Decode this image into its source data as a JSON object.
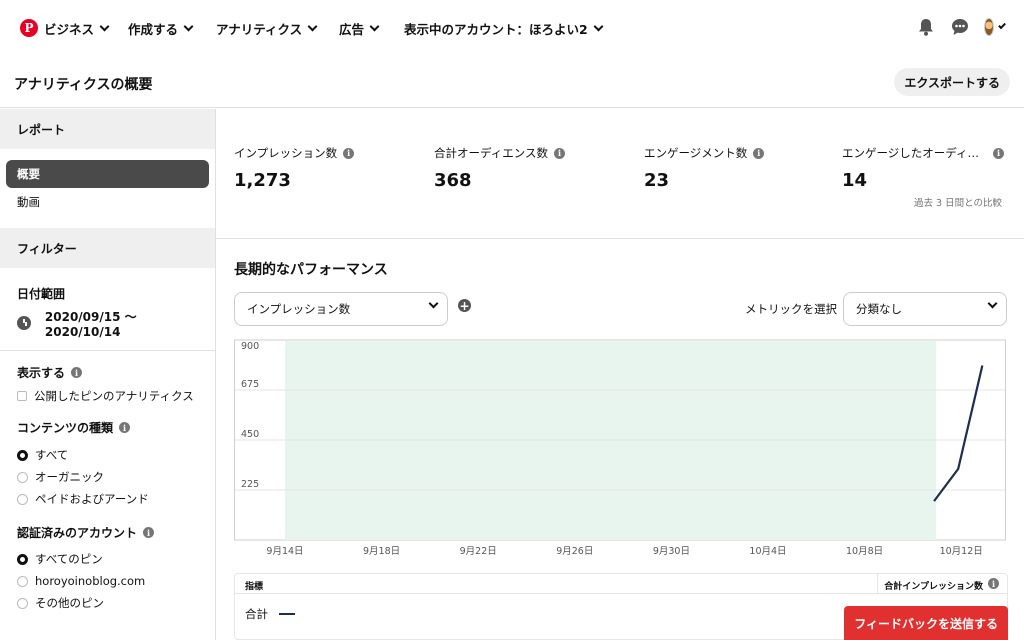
{
  "topnav": {
    "brand": "ビジネス",
    "logo_letter": "P",
    "items": [
      "作成する",
      "アナリティクス",
      "広告",
      "表示中のアカウント：ほろよい2"
    ],
    "icons": [
      "bell-icon",
      "chat-bubble-icon",
      "avatar"
    ]
  },
  "header": {
    "title": "アナリティクスの概要",
    "export_label": "エクスポートする"
  },
  "sidebar": {
    "report_head": "レポート",
    "report_items": [
      "概要",
      "動画"
    ],
    "filter_head": "フィルター",
    "date_label": "日付範囲",
    "date_value": "2020/09/15 〜 2020/10/14",
    "show_label": "表示する",
    "show_option": "公開したピンのアナリティクス",
    "content_label": "コンテンツの種類",
    "content_options": [
      "すべて",
      "オーガニック",
      "ペイドおよびアーンド"
    ],
    "account_label": "認証済みのアカウント",
    "account_options": [
      "すべてのピン",
      "horoyoinoblog.com",
      "その他のピン"
    ]
  },
  "metrics": [
    {
      "label": "インプレッション数",
      "value": "1,273"
    },
    {
      "label": "合計オーディエンス数",
      "value": "368"
    },
    {
      "label": "エンゲージメント数",
      "value": "23"
    },
    {
      "label": "エンゲージしたオーディ…",
      "value": "14"
    }
  ],
  "metrics_note": "過去 3 日間との比較",
  "performance": {
    "title": "長期的なパフォーマンス",
    "metric_select": "インプレッション数",
    "metric_pick_label": "メトリックを選択",
    "split_select": "分類なし"
  },
  "chart_data": {
    "type": "line",
    "x": [
      "10/11",
      "10/12",
      "10/13"
    ],
    "series": [
      {
        "values": [
          175,
          320,
          785
        ]
      }
    ],
    "ylim": [
      0,
      900
    ],
    "yticks": [
      225,
      450,
      675,
      900
    ],
    "xticks": [
      "9月14日",
      "9月18日",
      "9月22日",
      "9月26日",
      "9月30日",
      "10月4日",
      "10月8日",
      "10月12日"
    ],
    "grid": true,
    "line_color": "#1f2d4e",
    "shade_color": "#e8f5ee"
  },
  "table": {
    "col1": "指標",
    "col2": "合計インプレッション数",
    "row_label": "合計"
  },
  "feedback_label": "フィードバックを送信する",
  "colors": {
    "brand": "#e60023",
    "feedback": "#e03030",
    "active_item": "#4a4a4a"
  }
}
